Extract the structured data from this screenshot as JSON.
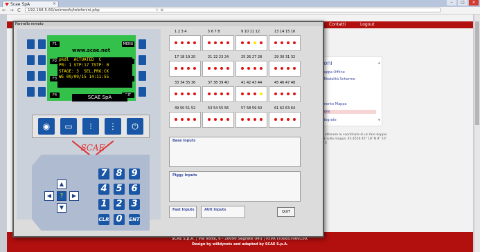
{
  "browser": {
    "tab_title": "Scae SpA",
    "url": "192.168.5.60/animeofs/telefonini.php",
    "nav_back": "←",
    "nav_forward": "→",
    "nav_reload": "C",
    "right_icons": "☆ ≡"
  },
  "site": {
    "nav_links": [
      "Contatti",
      "Logout"
    ],
    "side_title": "zioni",
    "side_links": [
      "Mappa Offline",
      "a Modalità Schermo"
    ],
    "side_title2": "e",
    "side_links2": [
      "amento Mappa",
      "etore",
      "odegrate"
    ],
    "note": "per ottenere le coordinate di un fare doppio click sulla mappa. 45.4556 45° 18' N 9° 10' 42\" E",
    "footer_line1": "SCAE S.p.A. | Via Volta, 6 - 20090 Segrate (MI) | P.IVA IT00857000150.",
    "footer_line2": "Design by willdynsts and adapted by SCAE S.p.A."
  },
  "popup": {
    "title": "Pannello remoto",
    "keys_left": [
      "F1",
      "F2",
      "F3",
      "F4"
    ],
    "keys_right": [
      "MENU",
      "ESC",
      "PRO",
      "RIT"
    ],
    "site_name": "www.scae.net",
    "lcd_lines": [
      "pkdl  ACTUATED  C",
      "PR: 1 STP:17 TSTP: 0",
      "STAGE: 3  SEL.PRG:CK",
      "WE 09/09/15 14:11:55"
    ],
    "brand": "SCAE SpA",
    "icon_buttons": [
      "fan-icon",
      "monitor-icon",
      "traffic-light-icon",
      "menu-icon",
      "power-icon"
    ],
    "logo_text": "SCAE",
    "numpad": [
      "7",
      "8",
      "9",
      "4",
      "5",
      "6",
      "1",
      "2",
      "3",
      "CLR",
      "0",
      "ENT"
    ],
    "arrows": {
      "up": "▲",
      "down": "▼",
      "left": "◀",
      "right": "▶",
      "center": "?"
    },
    "outputs": [
      [
        "1  2  3  4",
        "5  6  7  8",
        "9  10  11  12",
        "13  14  15  16"
      ],
      [
        "17  18  19  20",
        "21  22  23  24",
        "25  26  27  28",
        "29  30  31  32"
      ],
      [
        "33  34  35  36",
        "37  38  39  40",
        "41  42  43  44",
        "45  46  47  48"
      ],
      [
        "49  50  51  52",
        "53  54  55  56",
        "57  58  59  60",
        "61  62  63  64"
      ]
    ],
    "yellow_outputs": [
      11,
      44
    ],
    "base_inputs": "Base Inputs",
    "piggy_inputs": "Piggy Inputs",
    "fast_inputs": "Fast Inputs",
    "aux_inputs": "AUX Inputs",
    "quit": "QUIT",
    "colors": {
      "button_blue": "#1a56a6",
      "lcd_green": "#33c14c",
      "led_red": "#e01010",
      "led_yellow": "#ffe800",
      "site_red": "#b20f0f"
    }
  }
}
